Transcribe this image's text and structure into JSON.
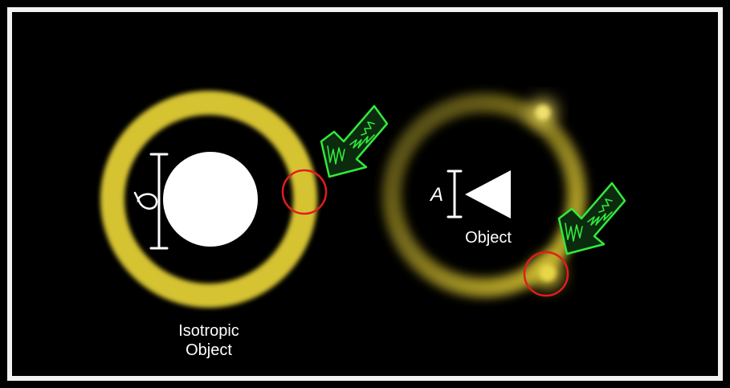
{
  "diagram": {
    "left_panel": {
      "ring_color": "#d8c530",
      "shape": "circle",
      "size_symbol": "σ",
      "caption_line1": "Isotropic",
      "caption_line2": "Object",
      "marker_color": "#e0201e",
      "arrow_color": "#2ee63a",
      "arrow_icon": "hand-drawn-arrow-icon"
    },
    "right_panel": {
      "ring_color": "#c8b82a",
      "shape": "triangle",
      "size_symbol": "A",
      "caption": "Object",
      "marker_color": "#e0201e",
      "arrow_color": "#2ee63a",
      "arrow_icon": "hand-drawn-arrow-icon"
    }
  }
}
